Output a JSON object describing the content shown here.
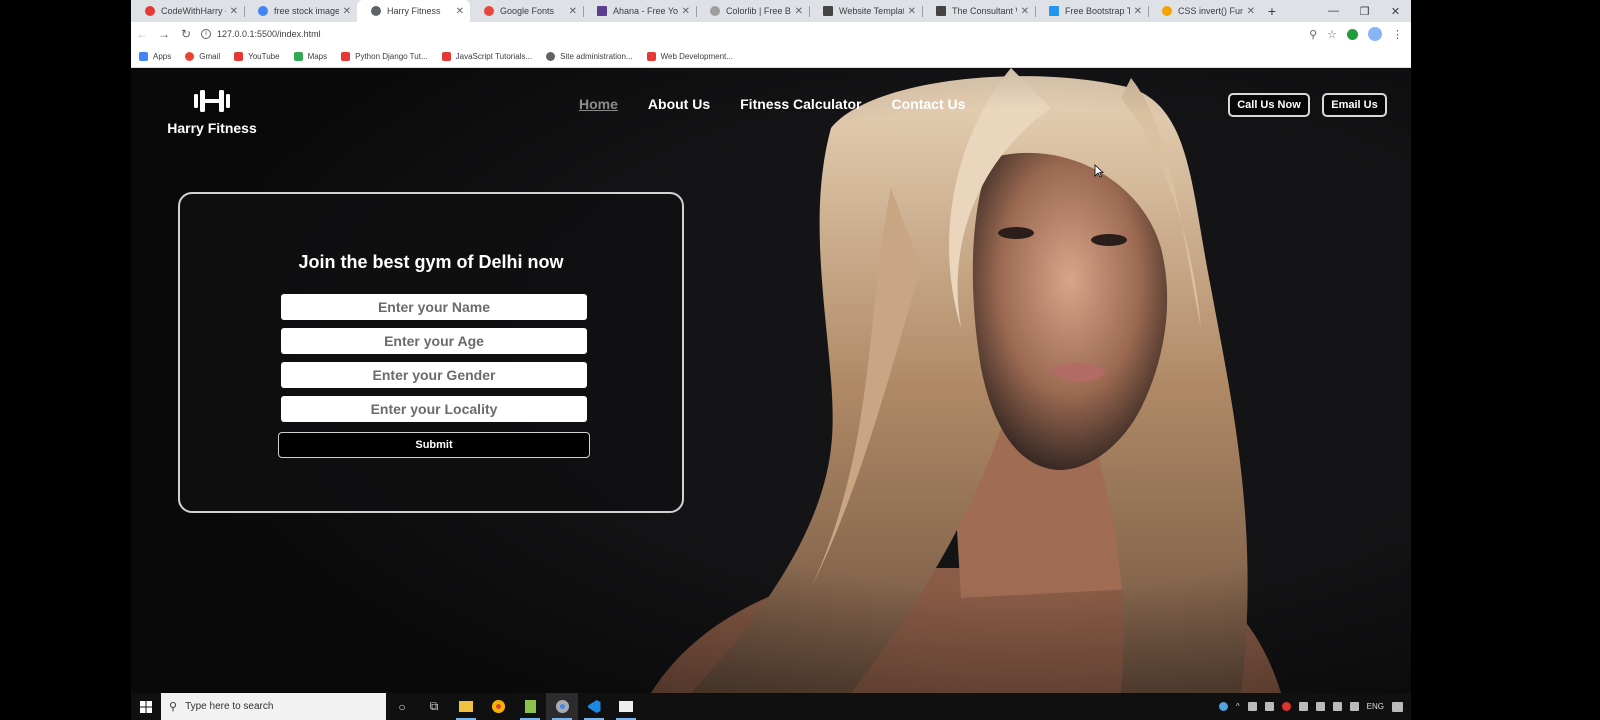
{
  "browser": {
    "tabs": [
      {
        "title": "CodeWithHarry - Yo",
        "favicon_color": "#e53935"
      },
      {
        "title": "free stock images -",
        "favicon_color": "#4285f4"
      },
      {
        "title": "Harry Fitness",
        "favicon_color": "#5f6368",
        "active": true
      },
      {
        "title": "Google Fonts",
        "favicon_color": "#e8453c"
      },
      {
        "title": "Ahana - Free Yoga",
        "favicon_color": "#5c3d8f"
      },
      {
        "title": "Colorlib | Free Boot",
        "favicon_color": "#9e9e9e"
      },
      {
        "title": "Website Templates |",
        "favicon_color": "#444444"
      },
      {
        "title": "The Consultant Web",
        "favicon_color": "#444444"
      },
      {
        "title": "Free Bootstrap The",
        "favicon_color": "#2196f3"
      },
      {
        "title": "CSS invert() Functi",
        "favicon_color": "#f4a300"
      }
    ],
    "new_tab": "+",
    "window_controls": {
      "minimize": "—",
      "restore": "❐",
      "close": "✕"
    },
    "url": "127.0.0.1:5500/index.html",
    "bookmarks": [
      {
        "label": "Apps",
        "icon_color": "#4285f4"
      },
      {
        "label": "Gmail",
        "icon_color": "#ea4335"
      },
      {
        "label": "YouTube",
        "icon_color": "#e53935"
      },
      {
        "label": "Maps",
        "icon_color": "#34a853"
      },
      {
        "label": "Python Django Tut...",
        "icon_color": "#e53935"
      },
      {
        "label": "JavaScript Tutorials...",
        "icon_color": "#e53935"
      },
      {
        "label": "Site administration...",
        "icon_color": "#5f6368"
      },
      {
        "label": "Web Development...",
        "icon_color": "#e53935"
      }
    ]
  },
  "site": {
    "brand": "Harry Fitness",
    "nav": [
      "Home",
      "About Us",
      "Fitness Calculator",
      "Contact Us"
    ],
    "cta_call": "Call Us Now",
    "cta_email": "Email Us",
    "form": {
      "title": "Join the best gym of Delhi now",
      "name_placeholder": "Enter your Name",
      "age_placeholder": "Enter your Age",
      "gender_placeholder": "Enter your Gender",
      "locality_placeholder": "Enter your Locality",
      "submit_label": "Submit"
    }
  },
  "taskbar": {
    "search_placeholder": "Type here to search",
    "language": "ENG"
  }
}
